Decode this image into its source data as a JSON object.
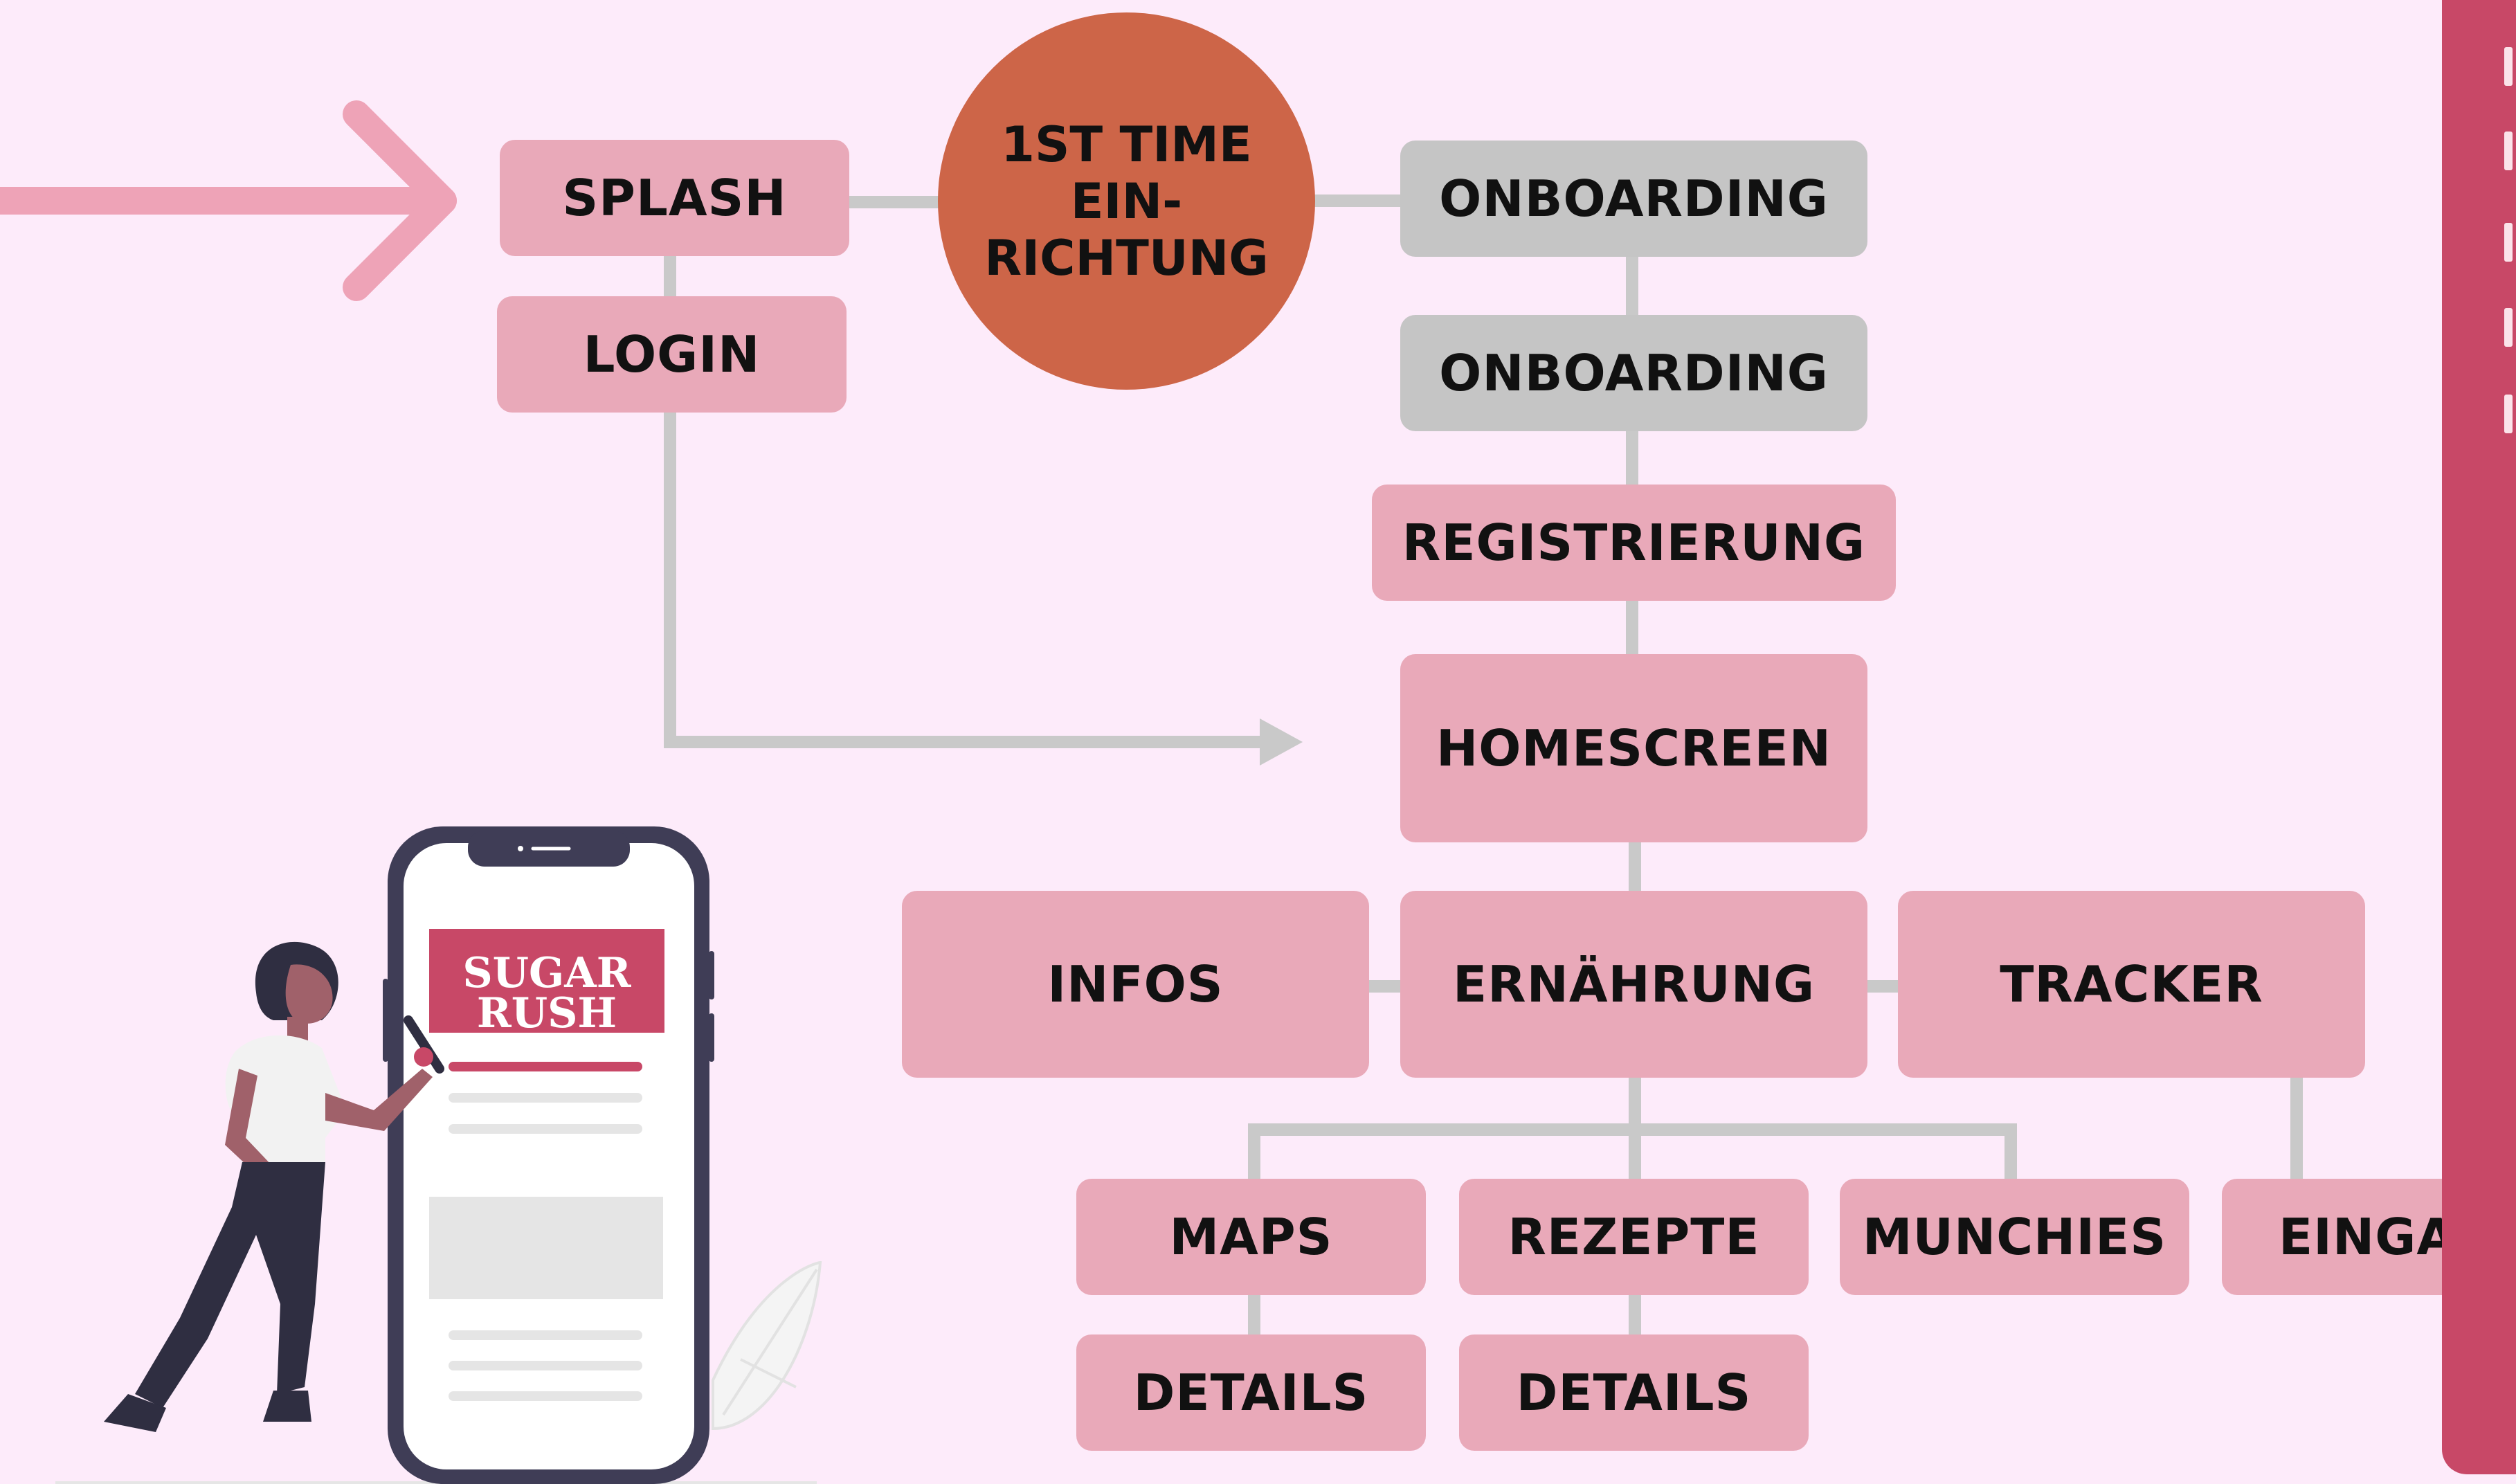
{
  "diagram": {
    "nodes": {
      "splash": "SPLASH",
      "login": "LOGIN",
      "first_time": [
        "1ST TIME",
        "EIN-",
        "RICHTUNG"
      ],
      "onboarding_1": "ONBOARDING",
      "onboarding_2": "ONBOARDING",
      "registrierung": "REGISTRIERUNG",
      "homescreen": "HOMESCREEN",
      "infos": "INFOS",
      "ernaehrung": "ERNÄHRUNG",
      "tracker": "TRACKER",
      "maps": "MAPS",
      "rezepte": "REZEPTE",
      "munchies": "MUNCHIES",
      "eingabe": "EINGABE",
      "details_1": "DETAILS",
      "details_2": "DETAILS"
    },
    "illustration": {
      "brand_line1": "SUGAR",
      "brand_line2": "RUSH"
    }
  },
  "colors": {
    "background": "#fdebfa",
    "pink_box": "#e9a9b9",
    "grey_box": "#c5c5c5",
    "circle": "#cd6548",
    "connector": "#c9c9c9",
    "entry_arrow": "#eea3b7",
    "side_panel": "#c84867"
  }
}
